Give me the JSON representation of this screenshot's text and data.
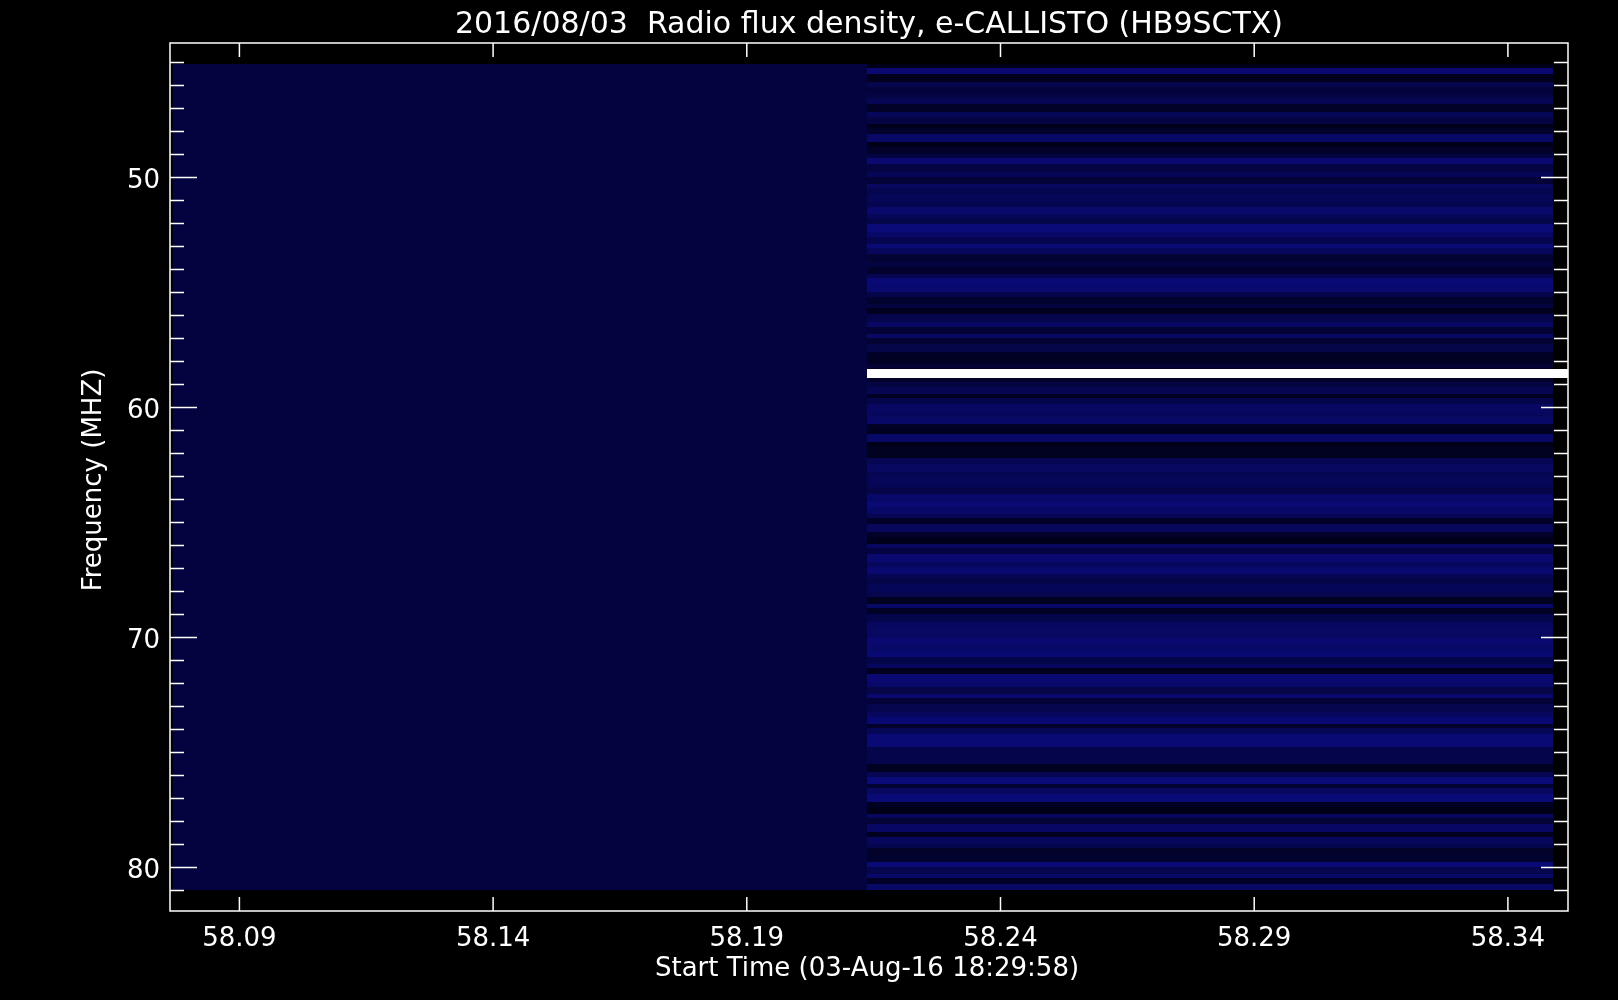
{
  "title": "2016/08/03  Radio flux density, e-CALLISTO (HB9SCTX)",
  "y_axis": {
    "label": "Frequency (MHZ)",
    "ticks": [
      "50",
      "60",
      "70",
      "80"
    ]
  },
  "x_axis": {
    "label": "Start Time (03-Aug-16 18:29:58)",
    "ticks": [
      "58.09",
      "58.14",
      "58.19",
      "58.24",
      "58.29",
      "58.34"
    ]
  }
}
